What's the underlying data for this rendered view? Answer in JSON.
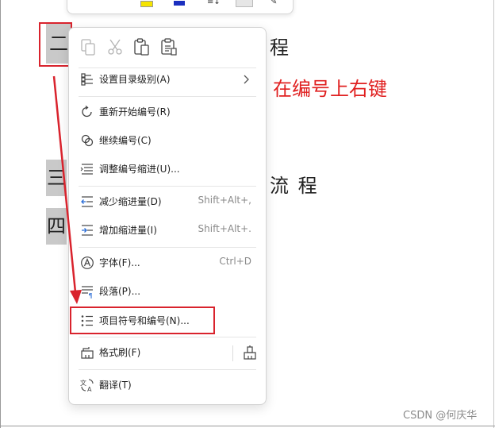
{
  "document": {
    "numbers": [
      "二",
      "三",
      "四"
    ],
    "line1_text": "程",
    "line2_text": "流 程"
  },
  "annotation": {
    "text": "在编号上右键",
    "color": "#e02020"
  },
  "context_menu": {
    "clipboard_icons": [
      "copy-icon",
      "cut-icon",
      "paste-icon",
      "paste-special-icon"
    ],
    "items": [
      {
        "label": "设置目录级别(A)",
        "shortcut": "",
        "icon": "toc-level-icon",
        "submenu": true
      },
      {
        "label": "重新开始编号(R)",
        "shortcut": "",
        "icon": "restart-numbering-icon"
      },
      {
        "label": "继续编号(C)",
        "shortcut": "",
        "icon": "continue-numbering-icon"
      },
      {
        "label": "调整编号缩进(U)...",
        "shortcut": "",
        "icon": "adjust-indent-icon"
      },
      {
        "label": "减少缩进量(D)",
        "shortcut": "Shift+Alt+,",
        "icon": "decrease-indent-icon"
      },
      {
        "label": "增加缩进量(I)",
        "shortcut": "Shift+Alt+.",
        "icon": "increase-indent-icon"
      },
      {
        "label": "字体(F)...",
        "shortcut": "Ctrl+D",
        "icon": "font-icon"
      },
      {
        "label": "段落(P)...",
        "shortcut": "",
        "icon": "paragraph-icon"
      },
      {
        "label": "项目符号和编号(N)...",
        "shortcut": "",
        "icon": "bullets-numbering-icon",
        "highlighted": true
      },
      {
        "label": "格式刷(F)",
        "shortcut": "",
        "icon": "format-painter-icon"
      },
      {
        "label": "翻译(T)",
        "shortcut": "",
        "icon": "translate-icon"
      }
    ]
  },
  "watermark": "CSDN @何庆华",
  "colors": {
    "highlight_box": "#d9232d",
    "number_bg": "#c9c9c9",
    "menu_icon": "#444444"
  }
}
